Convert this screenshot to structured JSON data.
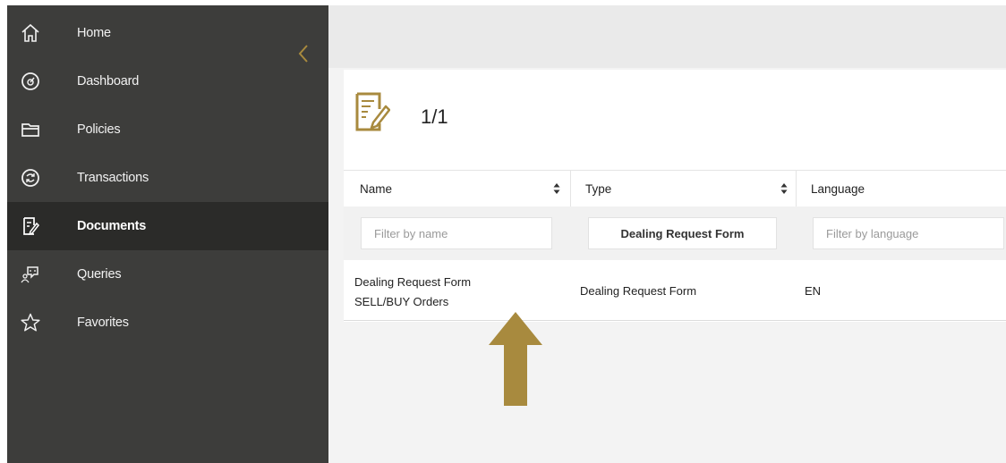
{
  "sidebar": {
    "items": [
      {
        "label": "Home",
        "icon": "home-icon",
        "active": false
      },
      {
        "label": "Dashboard",
        "icon": "dashboard-icon",
        "active": false
      },
      {
        "label": "Policies",
        "icon": "folder-icon",
        "active": false
      },
      {
        "label": "Transactions",
        "icon": "transactions-icon",
        "active": false
      },
      {
        "label": "Documents",
        "icon": "document-icon",
        "active": true
      },
      {
        "label": "Queries",
        "icon": "queries-icon",
        "active": false
      },
      {
        "label": "Favorites",
        "icon": "star-icon",
        "active": false
      }
    ],
    "collapse_icon": "chevron-left-icon"
  },
  "documents": {
    "count": "1/1",
    "icon": "document-edit-icon",
    "columns": [
      {
        "label": "Name",
        "sortable": true
      },
      {
        "label": "Type",
        "sortable": true
      },
      {
        "label": "Language",
        "sortable": true
      }
    ],
    "filters": {
      "name": {
        "placeholder": "Filter by name",
        "value": ""
      },
      "type": {
        "placeholder": "",
        "value": "Dealing Request Form"
      },
      "language": {
        "placeholder": "Filter by language",
        "value": ""
      }
    },
    "rows": [
      {
        "name_line1": "Dealing Request Form",
        "name_line2": "SELL/BUY Orders",
        "type": "Dealing Request Form",
        "language": "EN"
      }
    ]
  },
  "colors": {
    "sidebar_bg": "#3d3d3b",
    "sidebar_active_bg": "#2b2b29",
    "accent_gold": "#a88a3e",
    "arrow": "#a88a3e"
  },
  "annotation": {
    "icon": "up-arrow-icon"
  }
}
